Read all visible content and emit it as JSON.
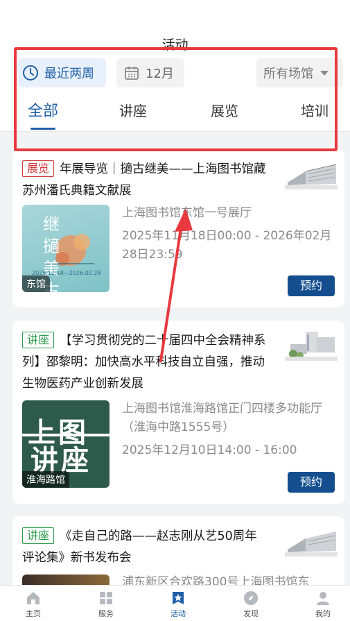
{
  "header": {
    "title": "活动"
  },
  "filters": {
    "date_range": "最近两周",
    "month": "12月",
    "venue": "所有场馆"
  },
  "tabs": [
    {
      "label": "全部",
      "active": true
    },
    {
      "label": "讲座",
      "active": false
    },
    {
      "label": "展览",
      "active": false
    },
    {
      "label": "培训",
      "active": false
    }
  ],
  "events": [
    {
      "tag": "展览",
      "title": "年展导览｜擿古继美——上海图书馆藏苏州潘氏典籍文献展",
      "venue": "上海图书馆东馆一号展厅",
      "time": "2025年11月18日00:00 - 2026年02月28日23:59",
      "poster_label": "东馆",
      "poster_text": "继 擿 美 古",
      "poster_date": "2025.11.18—2026.02.28",
      "book": "预约"
    },
    {
      "tag": "讲座",
      "title": "【学习贯彻党的二十届四中全会精神系列】邵黎明：加快高水平科技自立自强，推动生物医药产业创新发展",
      "venue": "上海图书馆淮海路馆正门四楼多功能厅（淮海中路1555号）",
      "time": "2025年12月10日14:00 - 16:00",
      "poster_label": "淮海路馆",
      "poster_line1": "上图",
      "poster_line2": "讲座",
      "book": "预约"
    },
    {
      "tag": "讲座",
      "title": "《走自己的路——赵志刚从艺50周年评论集》新书发布会",
      "venue": "浦东新区合欢路300号上海图书馆东"
    }
  ],
  "tabbar": [
    {
      "label": "主页",
      "icon": "home-icon"
    },
    {
      "label": "服务",
      "icon": "grid-icon"
    },
    {
      "label": "活动",
      "icon": "star-badge-icon",
      "active": true
    },
    {
      "label": "发现",
      "icon": "compass-icon"
    },
    {
      "label": "我的",
      "icon": "user-icon"
    }
  ],
  "colors": {
    "accent": "#1f5fa8",
    "button": "#144e8f",
    "highlight": "#e8393f"
  }
}
